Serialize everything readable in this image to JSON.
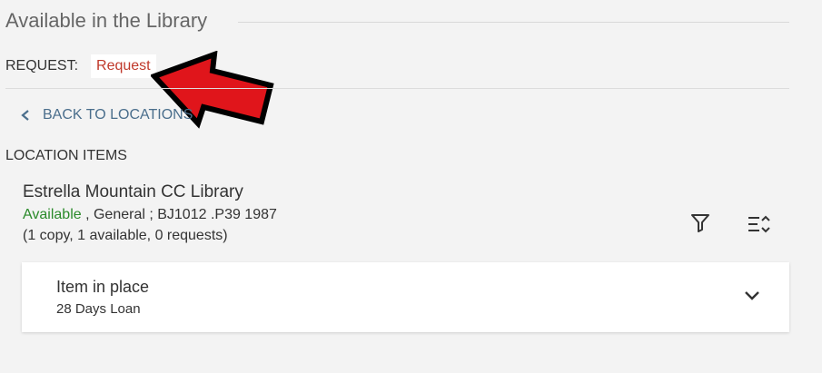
{
  "header": {
    "title": "Available in the Library"
  },
  "request": {
    "label": "REQUEST:",
    "link": "Request"
  },
  "navigation": {
    "back_label": "BACK TO LOCATIONS"
  },
  "location_items": {
    "heading": "LOCATION ITEMS",
    "library_name": "Estrella Mountain CC Library",
    "availability": "Available",
    "details": " , General ; BJ1012 .P39 1987",
    "copies": "(1 copy, 1 available, 0 requests)"
  },
  "item": {
    "status": "Item in place",
    "policy": "28 Days Loan"
  },
  "icons": {
    "back": "chevron-left-icon",
    "filter": "filter-icon",
    "sort": "sort-icon",
    "expand": "chevron-down-icon",
    "annotation": "red-arrow-icon"
  },
  "colors": {
    "background": "#f3f3f3",
    "request_link": "#c0392b",
    "available": "#2a8a2a",
    "back_link": "#4a6e8c",
    "annotation_arrow": "#e0151b"
  }
}
